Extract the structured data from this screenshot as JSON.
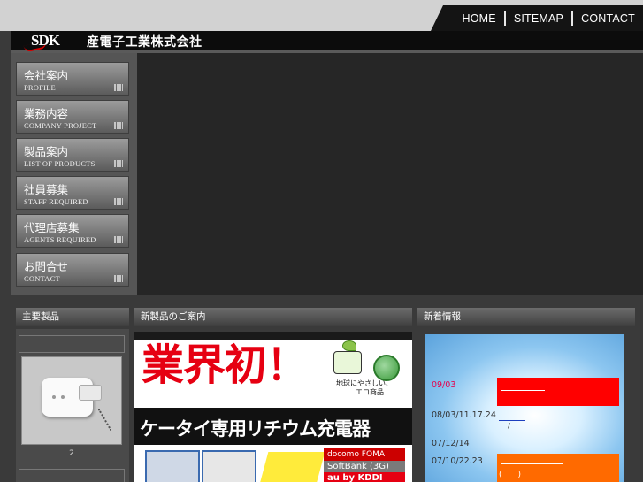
{
  "topnav": {
    "home": "HOME",
    "sitemap": "SITEMAP",
    "contact": "CONTACT"
  },
  "header": {
    "logo": "SDK",
    "company": "産電子工業株式会社"
  },
  "menu": [
    {
      "ja": "会社案内",
      "en": "PROFILE"
    },
    {
      "ja": "業務内容",
      "en": "COMPANY PROJECT"
    },
    {
      "ja": "製品案内",
      "en": "LIST OF PRODUCTS"
    },
    {
      "ja": "社員募集",
      "en": "STAFF REQUIRED"
    },
    {
      "ja": "代理店募集",
      "en": "AGENTS REQUIRED"
    },
    {
      "ja": "お問合せ",
      "en": "CONTACT"
    }
  ],
  "sections": {
    "main_products": "主要製品",
    "new_products": "新製品のご案内",
    "news": "新着情報"
  },
  "product": {
    "caption": "2"
  },
  "banner": {
    "headline": "業界初！",
    "eco_line1": "地球にやさしい、",
    "eco_line2": "エコ商品",
    "subhead": "ケータイ専用リチウム充電器",
    "carrier_docomo": "docomo FOMA",
    "carrier_softbank": "SoftBank (3G)",
    "carrier_au": "au by KDDI CDMA"
  },
  "news": [
    {
      "date": "09/03",
      "date_color": "#e6004c"
    },
    {
      "date": "08/03/11.17.24"
    },
    {
      "date": "07/12/14"
    },
    {
      "date": "07/10/22.23"
    }
  ],
  "news_slash": "/",
  "news_paren": "(　　)",
  "colors": {
    "accent_red": "#ff0000",
    "news_orange": "#ff6a00",
    "link_blue": "#1d3fbf"
  }
}
